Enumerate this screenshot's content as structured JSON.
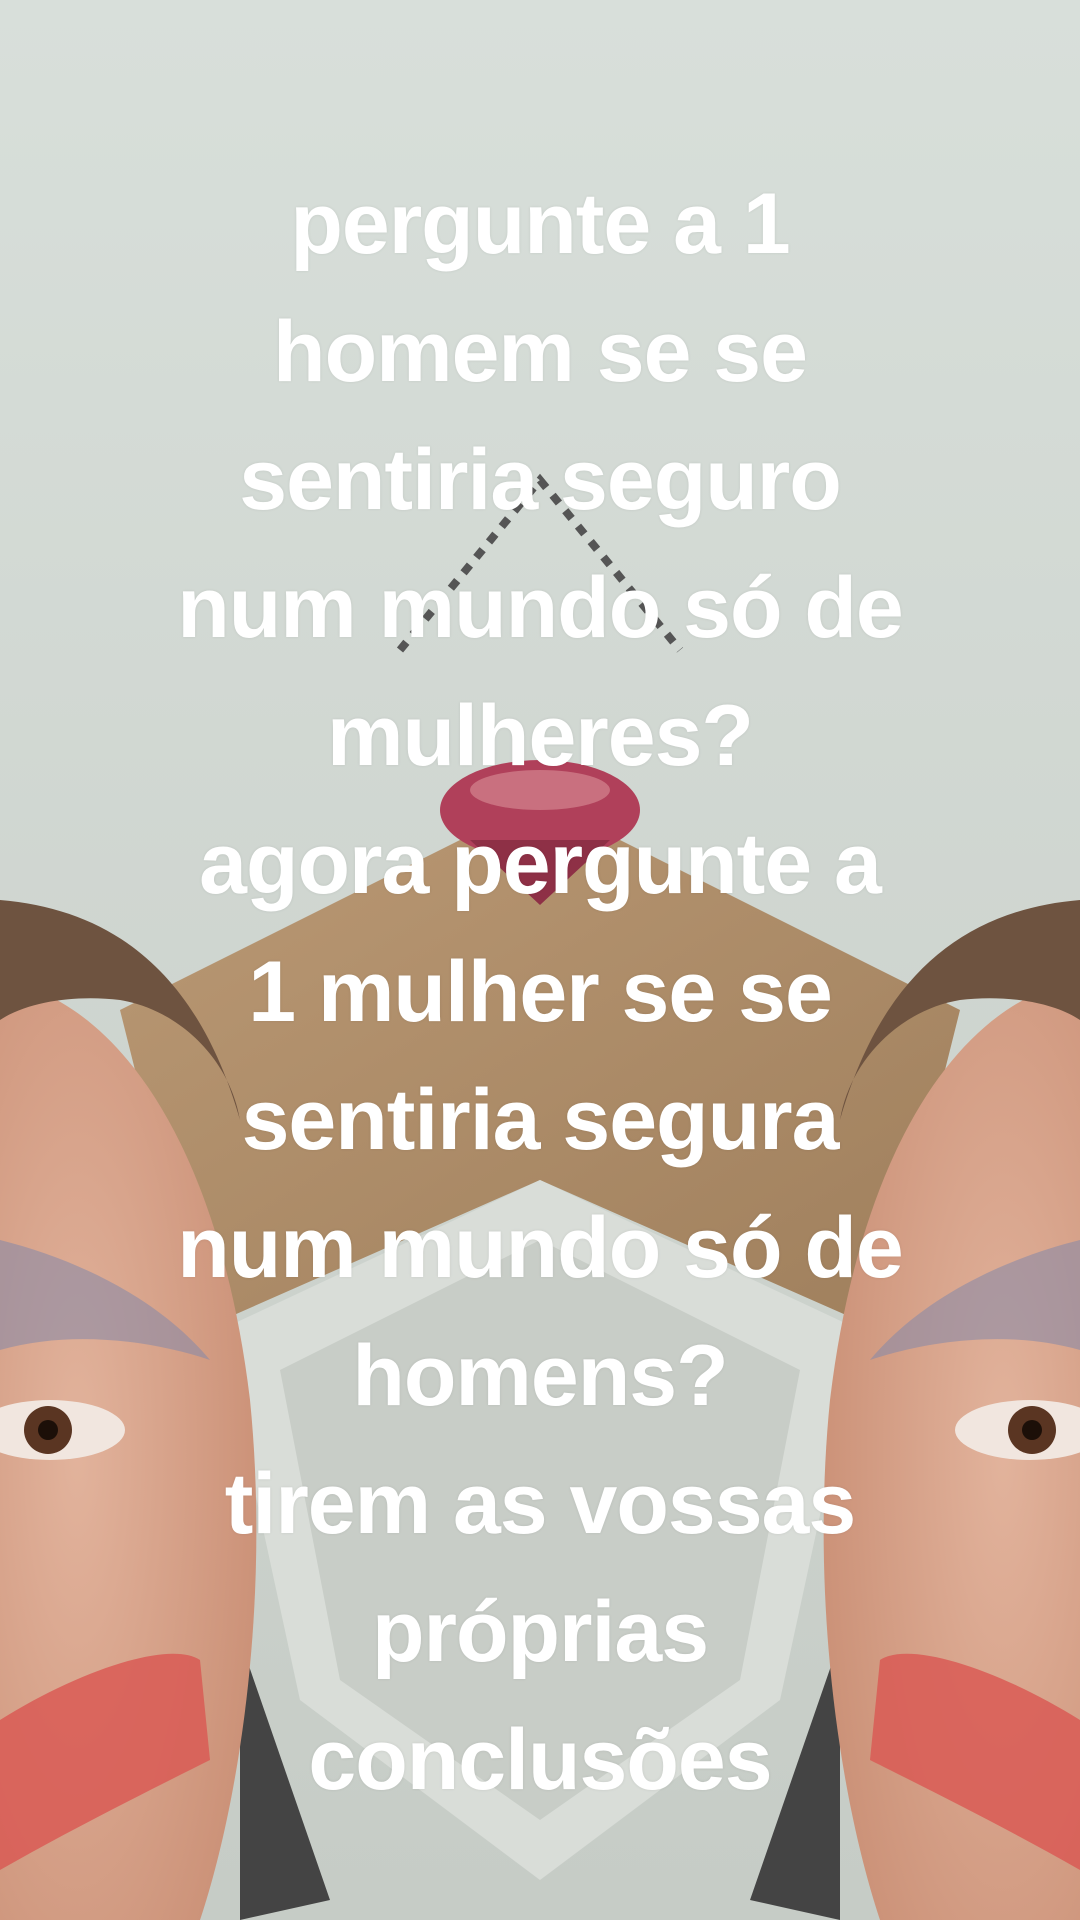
{
  "caption": {
    "lines": [
      "pergunte a 1",
      "homem se se",
      "sentiria seguro",
      "num mundo só de",
      "mulheres?",
      "agora pergunte a",
      "1 mulher se se",
      "sentiria segura",
      "num mundo só de",
      "homens?",
      "tirem as vossas",
      "próprias",
      "conclusões"
    ],
    "color": "#ffffff"
  },
  "scene": {
    "description_icon": "mirrored-face-effect",
    "colors": {
      "wall": "#d4dbd6",
      "door_wood": "#b08a5e",
      "skin": "#d8a48c",
      "hair": "#6e5340",
      "blush": "#d95b55",
      "lips": "#b0405a"
    }
  }
}
